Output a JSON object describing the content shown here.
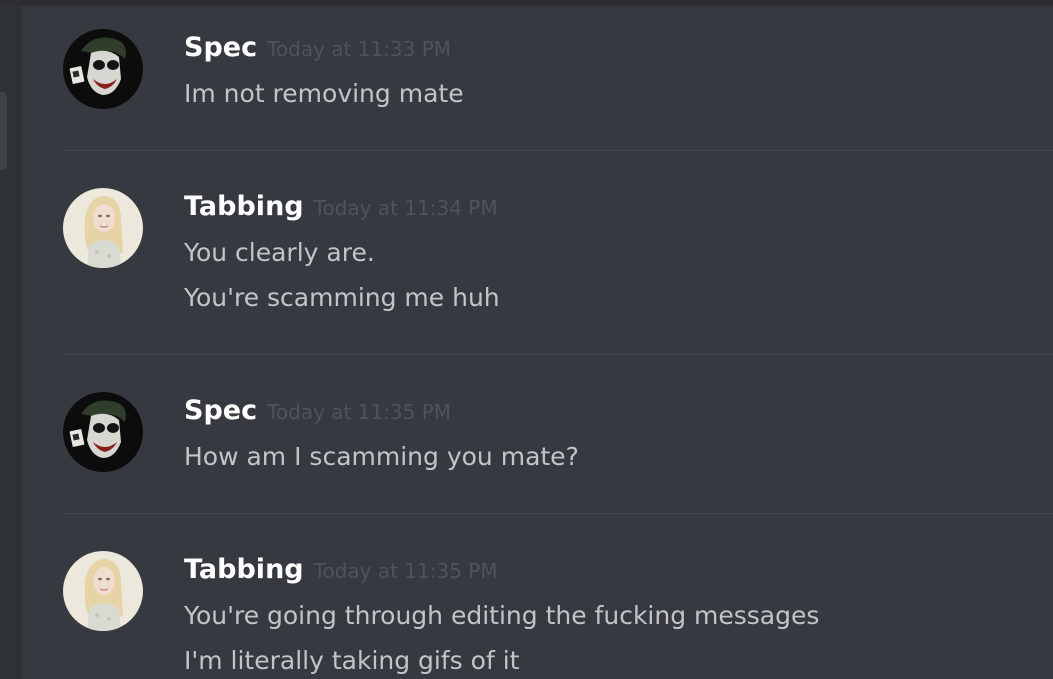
{
  "messages": [
    {
      "author": "Spec",
      "timestamp": "Today at 11:33 PM",
      "avatar_icon": "joker-avatar-icon",
      "lines": [
        "Im not removing mate"
      ]
    },
    {
      "author": "Tabbing",
      "timestamp": "Today at 11:34 PM",
      "avatar_icon": "blonde-woman-avatar-icon",
      "lines": [
        "You clearly are.",
        "You're scamming me huh"
      ]
    },
    {
      "author": "Spec",
      "timestamp": "Today at 11:35 PM",
      "avatar_icon": "joker-avatar-icon",
      "lines": [
        "How am I scamming you mate?"
      ]
    },
    {
      "author": "Tabbing",
      "timestamp": "Today at 11:35 PM",
      "avatar_icon": "blonde-woman-avatar-icon",
      "lines": [
        "You're going through editing the fucking messages",
        "I'm literally taking gifs of it"
      ]
    }
  ],
  "colors": {
    "background": "#36393f",
    "username": "#ffffff",
    "timestamp": "#4f535a",
    "message_text": "#c2c5c8",
    "divider": "#42454b"
  }
}
